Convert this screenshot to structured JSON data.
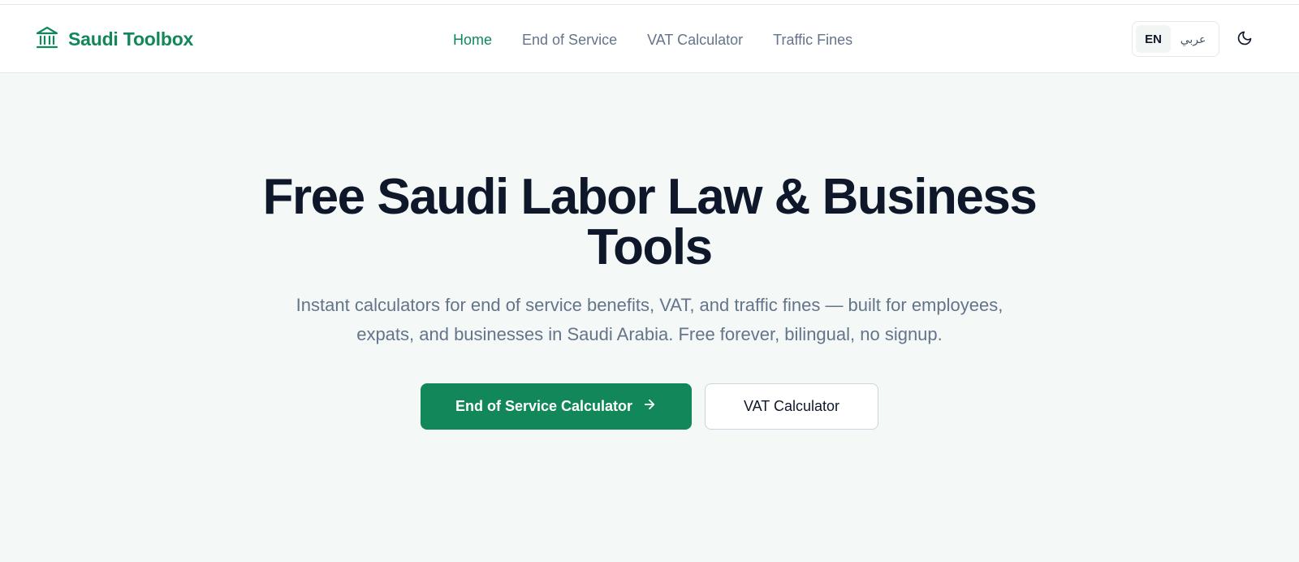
{
  "brand": {
    "name": "Saudi Toolbox",
    "icon": "bank-icon"
  },
  "nav": {
    "items": [
      {
        "label": "Home",
        "active": true
      },
      {
        "label": "End of Service",
        "active": false
      },
      {
        "label": "VAT Calculator",
        "active": false
      },
      {
        "label": "Traffic Fines",
        "active": false
      }
    ]
  },
  "language": {
    "en": "EN",
    "ar": "عربي",
    "selected": "EN"
  },
  "theme_toggle": {
    "icon": "moon-icon"
  },
  "hero": {
    "title": "Free Saudi Labor Law & Business Tools",
    "subtitle": "Instant calculators for end of service benefits, VAT, and traffic fines — built for employees, expats, and businesses in Saudi Arabia. Free forever, bilingual, no signup.",
    "primary_label": "End of Service Calculator",
    "primary_icon": "arrow-right-icon",
    "secondary_label": "VAT Calculator"
  },
  "colors": {
    "brand": "#11875a",
    "background": "#f4f8f7",
    "text_dark": "#0f172a",
    "text_muted": "#64748b"
  }
}
